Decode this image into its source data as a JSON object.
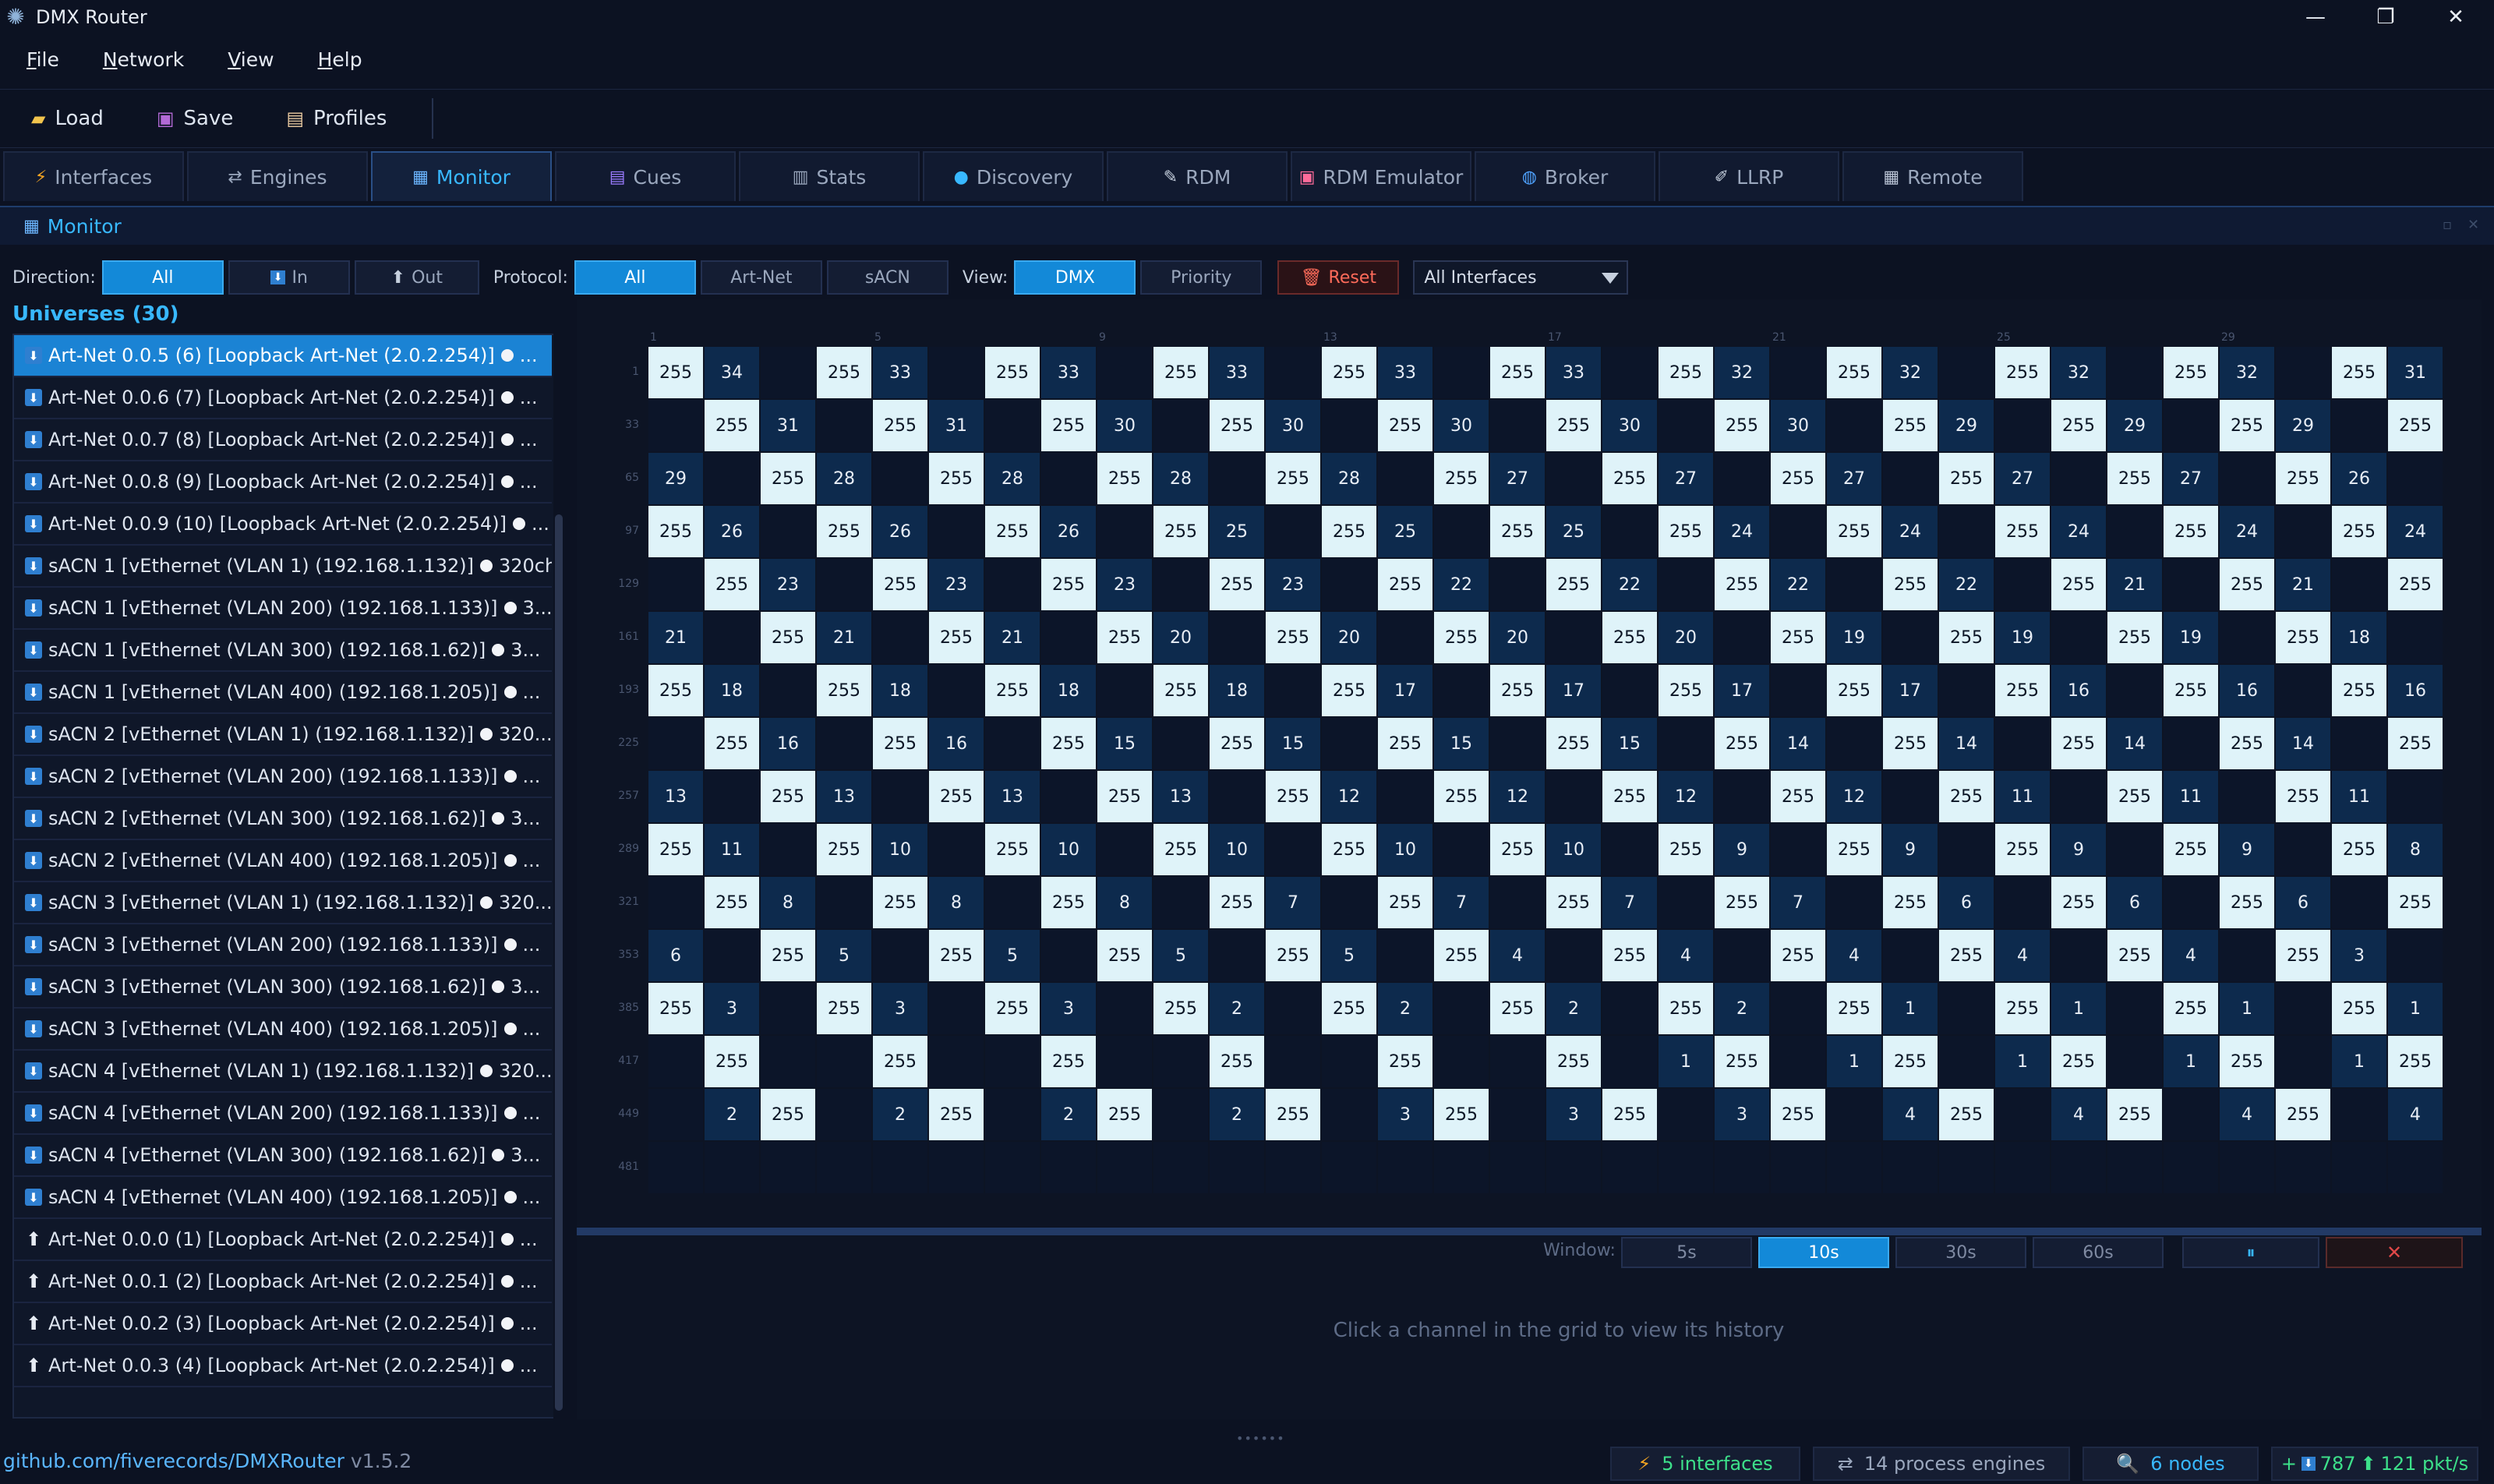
{
  "app": {
    "title": "DMX Router"
  },
  "menu": [
    {
      "label": "File",
      "u": "F",
      "rest": "ile"
    },
    {
      "label": "Network",
      "u": "N",
      "rest": "etwork"
    },
    {
      "label": "View",
      "u": "V",
      "rest": "iew"
    },
    {
      "label": "Help",
      "u": "H",
      "rest": "elp"
    }
  ],
  "toolbar": {
    "load": "Load",
    "save": "Save",
    "profiles": "Profiles"
  },
  "tabs": [
    "Interfaces",
    "Engines",
    "Monitor",
    "Cues",
    "Stats",
    "Discovery",
    "RDM",
    "RDM Emulator",
    "Broker",
    "LLRP",
    "Remote"
  ],
  "active_tab": "Monitor",
  "panel": {
    "title": "Monitor"
  },
  "filters": {
    "direction_label": "Direction:",
    "direction_options": [
      "All",
      "In",
      "Out"
    ],
    "direction_selected": "All",
    "protocol_label": "Protocol:",
    "protocol_options": [
      "All",
      "Art-Net",
      "sACN"
    ],
    "protocol_selected": "All",
    "view_label": "View:",
    "view_options": [
      "DMX",
      "Priority"
    ],
    "view_selected": "DMX",
    "reset": "Reset",
    "interface_select": "All Interfaces"
  },
  "universes": {
    "title": "Universes (30)",
    "items": [
      {
        "dir": "in",
        "label": "Art-Net 0.0.5 (6) [Loopback Art-Net (2.0.2.254)]",
        "suffix": "...",
        "selected": true
      },
      {
        "dir": "in",
        "label": "Art-Net 0.0.6 (7) [Loopback Art-Net (2.0.2.254)]",
        "suffix": "..."
      },
      {
        "dir": "in",
        "label": "Art-Net 0.0.7 (8) [Loopback Art-Net (2.0.2.254)]",
        "suffix": "..."
      },
      {
        "dir": "in",
        "label": "Art-Net 0.0.8 (9) [Loopback Art-Net (2.0.2.254)]",
        "suffix": "..."
      },
      {
        "dir": "in",
        "label": "Art-Net 0.0.9 (10) [Loopback Art-Net (2.0.2.254)]",
        "suffix": "..."
      },
      {
        "dir": "in",
        "label": "sACN 1 [vEthernet (VLAN 1) (192.168.1.132)]",
        "suffix": "320ch"
      },
      {
        "dir": "in",
        "label": "sACN 1 [vEthernet (VLAN 200) (192.168.1.133)]",
        "suffix": "3..."
      },
      {
        "dir": "in",
        "label": "sACN 1 [vEthernet (VLAN 300) (192.168.1.62)]",
        "suffix": "3..."
      },
      {
        "dir": "in",
        "label": "sACN 1 [vEthernet (VLAN 400) (192.168.1.205)]",
        "suffix": "..."
      },
      {
        "dir": "in",
        "label": "sACN 2 [vEthernet (VLAN 1) (192.168.1.132)]",
        "suffix": "320..."
      },
      {
        "dir": "in",
        "label": "sACN 2 [vEthernet (VLAN 200) (192.168.1.133)]",
        "suffix": "..."
      },
      {
        "dir": "in",
        "label": "sACN 2 [vEthernet (VLAN 300) (192.168.1.62)]",
        "suffix": "3..."
      },
      {
        "dir": "in",
        "label": "sACN 2 [vEthernet (VLAN 400) (192.168.1.205)]",
        "suffix": "..."
      },
      {
        "dir": "in",
        "label": "sACN 3 [vEthernet (VLAN 1) (192.168.1.132)]",
        "suffix": "320..."
      },
      {
        "dir": "in",
        "label": "sACN 3 [vEthernet (VLAN 200) (192.168.1.133)]",
        "suffix": "..."
      },
      {
        "dir": "in",
        "label": "sACN 3 [vEthernet (VLAN 300) (192.168.1.62)]",
        "suffix": "3..."
      },
      {
        "dir": "in",
        "label": "sACN 3 [vEthernet (VLAN 400) (192.168.1.205)]",
        "suffix": "..."
      },
      {
        "dir": "in",
        "label": "sACN 4 [vEthernet (VLAN 1) (192.168.1.132)]",
        "suffix": "320..."
      },
      {
        "dir": "in",
        "label": "sACN 4 [vEthernet (VLAN 200) (192.168.1.133)]",
        "suffix": "..."
      },
      {
        "dir": "in",
        "label": "sACN 4 [vEthernet (VLAN 300) (192.168.1.62)]",
        "suffix": "3..."
      },
      {
        "dir": "in",
        "label": "sACN 4 [vEthernet (VLAN 400) (192.168.1.205)]",
        "suffix": "..."
      },
      {
        "dir": "out",
        "label": "Art-Net 0.0.0 (1) [Loopback Art-Net (2.0.2.254)]",
        "suffix": "..."
      },
      {
        "dir": "out",
        "label": "Art-Net 0.0.1 (2) [Loopback Art-Net (2.0.2.254)]",
        "suffix": "..."
      },
      {
        "dir": "out",
        "label": "Art-Net 0.0.2 (3) [Loopback Art-Net (2.0.2.254)]",
        "suffix": "..."
      },
      {
        "dir": "out",
        "label": "Art-Net 0.0.3 (4) [Loopback Art-Net (2.0.2.254)]",
        "suffix": "..."
      }
    ]
  },
  "grid": {
    "col_labels": [
      "1",
      "5",
      "9",
      "13",
      "17",
      "21",
      "25",
      "29"
    ],
    "row_labels": [
      "1",
      "33",
      "65",
      "97",
      "129",
      "161",
      "193",
      "225",
      "257",
      "289",
      "321",
      "353",
      "385",
      "417",
      "449",
      "481"
    ],
    "rows": [
      [
        255,
        34,
        0,
        255,
        33,
        0,
        255,
        33,
        0,
        255,
        33,
        0,
        255,
        33,
        0,
        255,
        33,
        0,
        255,
        32,
        0,
        255,
        32,
        0,
        255,
        32,
        0,
        255,
        32,
        0,
        255,
        31
      ],
      [
        0,
        255,
        31,
        0,
        255,
        31,
        0,
        255,
        30,
        0,
        255,
        30,
        0,
        255,
        30,
        0,
        255,
        30,
        0,
        255,
        30,
        0,
        255,
        29,
        0,
        255,
        29,
        0,
        255,
        29,
        0,
        255
      ],
      [
        29,
        0,
        255,
        28,
        0,
        255,
        28,
        0,
        255,
        28,
        0,
        255,
        28,
        0,
        255,
        27,
        0,
        255,
        27,
        0,
        255,
        27,
        0,
        255,
        27,
        0,
        255,
        27,
        0,
        255,
        26,
        0
      ],
      [
        255,
        26,
        0,
        255,
        26,
        0,
        255,
        26,
        0,
        255,
        25,
        0,
        255,
        25,
        0,
        255,
        25,
        0,
        255,
        24,
        0,
        255,
        24,
        0,
        255,
        24,
        0,
        255,
        24,
        0,
        255,
        24
      ],
      [
        0,
        255,
        23,
        0,
        255,
        23,
        0,
        255,
        23,
        0,
        255,
        23,
        0,
        255,
        22,
        0,
        255,
        22,
        0,
        255,
        22,
        0,
        255,
        22,
        0,
        255,
        21,
        0,
        255,
        21,
        0,
        255
      ],
      [
        21,
        0,
        255,
        21,
        0,
        255,
        21,
        0,
        255,
        20,
        0,
        255,
        20,
        0,
        255,
        20,
        0,
        255,
        20,
        0,
        255,
        19,
        0,
        255,
        19,
        0,
        255,
        19,
        0,
        255,
        18,
        0
      ],
      [
        255,
        18,
        0,
        255,
        18,
        0,
        255,
        18,
        0,
        255,
        18,
        0,
        255,
        17,
        0,
        255,
        17,
        0,
        255,
        17,
        0,
        255,
        17,
        0,
        255,
        16,
        0,
        255,
        16,
        0,
        255,
        16
      ],
      [
        0,
        255,
        16,
        0,
        255,
        16,
        0,
        255,
        15,
        0,
        255,
        15,
        0,
        255,
        15,
        0,
        255,
        15,
        0,
        255,
        14,
        0,
        255,
        14,
        0,
        255,
        14,
        0,
        255,
        14,
        0,
        255
      ],
      [
        13,
        0,
        255,
        13,
        0,
        255,
        13,
        0,
        255,
        13,
        0,
        255,
        12,
        0,
        255,
        12,
        0,
        255,
        12,
        0,
        255,
        12,
        0,
        255,
        11,
        0,
        255,
        11,
        0,
        255,
        11,
        0
      ],
      [
        255,
        11,
        0,
        255,
        10,
        0,
        255,
        10,
        0,
        255,
        10,
        0,
        255,
        10,
        0,
        255,
        10,
        0,
        255,
        9,
        0,
        255,
        9,
        0,
        255,
        9,
        0,
        255,
        9,
        0,
        255,
        8
      ],
      [
        0,
        255,
        8,
        0,
        255,
        8,
        0,
        255,
        8,
        0,
        255,
        7,
        0,
        255,
        7,
        0,
        255,
        7,
        0,
        255,
        7,
        0,
        255,
        6,
        0,
        255,
        6,
        0,
        255,
        6,
        0,
        255
      ],
      [
        6,
        0,
        255,
        5,
        0,
        255,
        5,
        0,
        255,
        5,
        0,
        255,
        5,
        0,
        255,
        4,
        0,
        255,
        4,
        0,
        255,
        4,
        0,
        255,
        4,
        0,
        255,
        4,
        0,
        255,
        3,
        0
      ],
      [
        255,
        3,
        0,
        255,
        3,
        0,
        255,
        3,
        0,
        255,
        2,
        0,
        255,
        2,
        0,
        255,
        2,
        0,
        255,
        2,
        0,
        255,
        1,
        0,
        255,
        1,
        0,
        255,
        1,
        0,
        255,
        1
      ],
      [
        0,
        255,
        0,
        0,
        255,
        0,
        0,
        255,
        0,
        0,
        255,
        0,
        0,
        255,
        0,
        0,
        255,
        0,
        1,
        255,
        0,
        1,
        255,
        0,
        1,
        255,
        0,
        1,
        255,
        0,
        1,
        255
      ],
      [
        0,
        2,
        255,
        0,
        2,
        255,
        0,
        2,
        255,
        0,
        2,
        255,
        0,
        3,
        255,
        0,
        3,
        255,
        0,
        3,
        255,
        0,
        4,
        255,
        0,
        4,
        255,
        0,
        4,
        255,
        0,
        4
      ],
      [
        0,
        0,
        0,
        0,
        0,
        0,
        0,
        0,
        0,
        0,
        0,
        0,
        0,
        0,
        0,
        0,
        0,
        0,
        0,
        0,
        0,
        0,
        0,
        0,
        0,
        0,
        0,
        0,
        0,
        0,
        0,
        0
      ]
    ]
  },
  "history": {
    "window_label": "Window:",
    "windows": [
      "5s",
      "10s",
      "30s",
      "60s"
    ],
    "window_selected": "10s",
    "pause_icon": "pause-icon",
    "close_icon": "close-icon",
    "message": "Click a channel in the grid to view its history"
  },
  "status": {
    "github": "github.com/fiverecords/DMXRouter",
    "version": "v1.5.2",
    "interfaces": "5 interfaces",
    "engines": "14 process engines",
    "nodes": "6 nodes",
    "in_rate": "787",
    "out_rate": "121 pkt/s"
  },
  "colors": {
    "accent": "#38b8ff",
    "selected": "#1b83d4",
    "cell_full": "#dff3f9",
    "cell_mid": "#0d2a4d",
    "cell_empty": "#0c1529",
    "reset": "#ff6b5a",
    "status_green": "#3de08a",
    "interfaces_orange": "#f5a623"
  }
}
